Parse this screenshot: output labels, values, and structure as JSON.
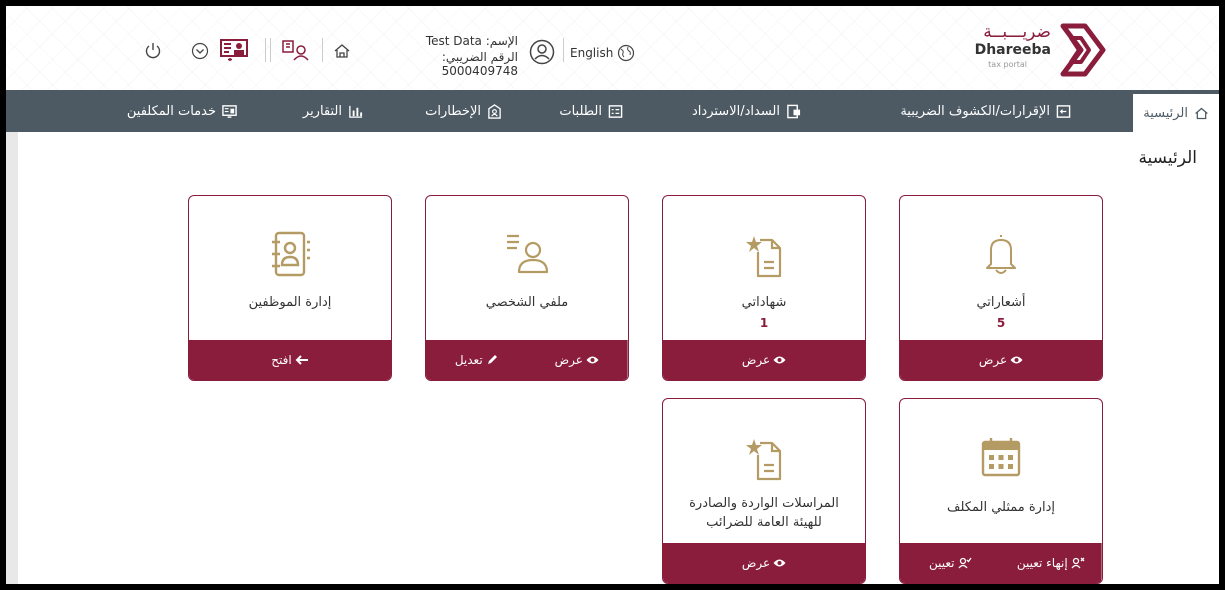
{
  "header": {
    "logo_ar": "ضريـــبــة",
    "logo_en": "Dhareeba",
    "logo_sub": "tax portal",
    "language": "English",
    "user_name": "الإسم: Test Data",
    "user_tax_number": "الرقم الضريبي: 5000409748"
  },
  "nav": {
    "items": [
      {
        "label": "الرئيسية",
        "icon": "home-icon"
      },
      {
        "label": "الإقرارات/الكشوف الضريبية",
        "icon": "return-icon"
      },
      {
        "label": "السداد/الاسترداد",
        "icon": "payment-icon"
      },
      {
        "label": "الطلبات",
        "icon": "requests-icon"
      },
      {
        "label": "الإخطارات",
        "icon": "notices-icon"
      },
      {
        "label": "التقارير",
        "icon": "bar-chart-icon"
      },
      {
        "label": "خدمات المكلفين",
        "icon": "services-icon"
      }
    ]
  },
  "page": {
    "title": "الرئيسية"
  },
  "cards": {
    "notifications": {
      "title": "أشعاراتي",
      "count": "5",
      "view": "عرض"
    },
    "certificates": {
      "title": "شهاداتي",
      "count": "1",
      "view": "عرض"
    },
    "profile": {
      "title": "ملفي الشخصي",
      "edit": "تعديل",
      "view": "عرض"
    },
    "employees": {
      "title": "إدارة الموظفين",
      "open": "افتح"
    },
    "representatives": {
      "title": "إدارة ممثلي المكلف",
      "assign": "تعيين",
      "end_assign": "إنهاء تعيين"
    },
    "correspondence": {
      "title_line1": "المراسلات الواردة والصادرة",
      "title_line2": "للهيئة العامة للضرائب",
      "view": "عرض"
    }
  },
  "colors": {
    "brand": "#8a1c3c",
    "nav_bg": "#4d5a64",
    "icon_gold": "#b49a63"
  }
}
